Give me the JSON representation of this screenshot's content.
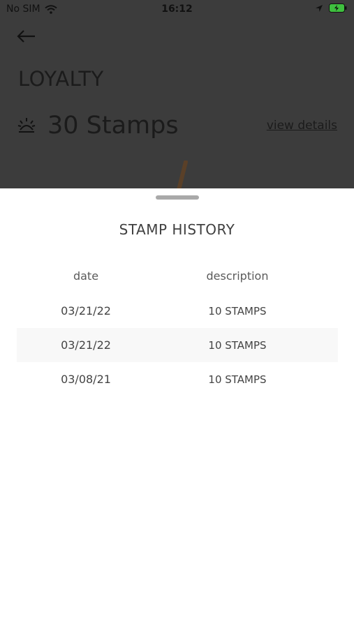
{
  "status_bar": {
    "carrier": "No SIM",
    "time": "16:12"
  },
  "header": {
    "title": "LOYALTY",
    "stamps": "30 Stamps",
    "view_details": "view details"
  },
  "sheet": {
    "title": "STAMP HISTORY",
    "columns": {
      "date": "date",
      "description": "description"
    },
    "rows": [
      {
        "date": "03/21/22",
        "description": "10 STAMPS"
      },
      {
        "date": "03/21/22",
        "description": "10 STAMPS"
      },
      {
        "date": "03/08/21",
        "description": "10 STAMPS"
      }
    ]
  },
  "colors": {
    "overlay": "#3c3c3c",
    "battery": "#3fbf3f",
    "stick": "#5a4028"
  }
}
